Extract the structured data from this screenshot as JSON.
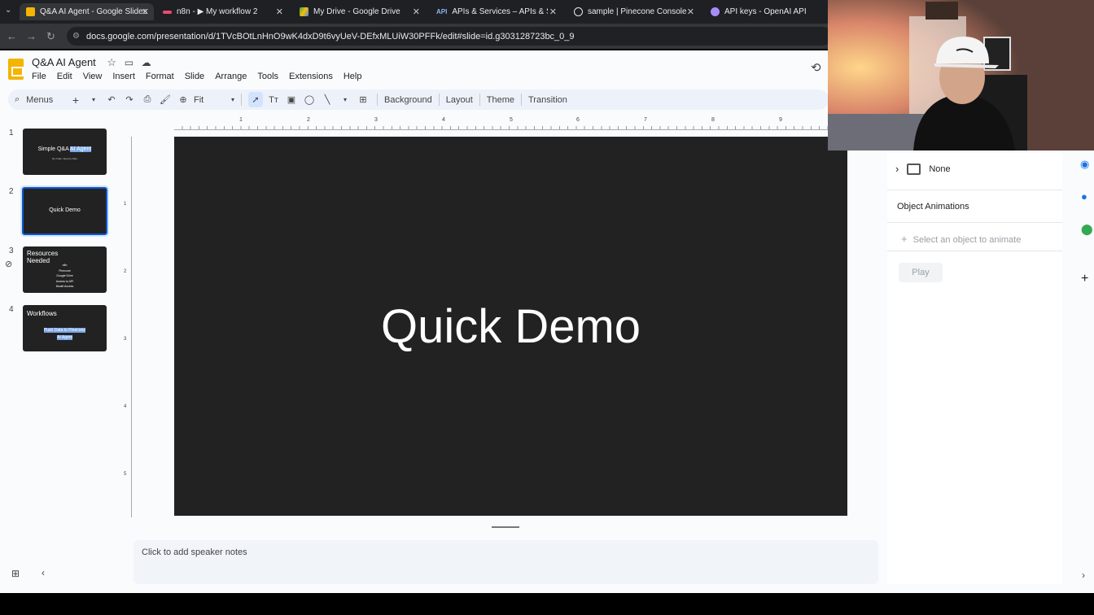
{
  "browser": {
    "tabs": [
      {
        "title": "Q&A AI Agent - Google Slides",
        "icon": "slides-icon",
        "color": "#f4b400"
      },
      {
        "title": "n8n - ▶ My workflow 2",
        "icon": "n8n-icon",
        "color": "#ea4b71"
      },
      {
        "title": "My Drive - Google Drive",
        "icon": "drive-icon",
        "color": "#34a853"
      },
      {
        "title": "APIs & Services – APIs & Servic",
        "icon": "api-icon",
        "color": "#8ab4f8"
      },
      {
        "title": "sample | Pinecone Console",
        "icon": "pinecone-icon",
        "color": "#e8eaed"
      },
      {
        "title": "API keys - OpenAI API",
        "icon": "openai-icon",
        "color": "#a78bfa"
      }
    ],
    "url": "docs.google.com/presentation/d/1TVcBOtLnHnO9wK4dxD9t6vyUeV-DEfxMLUiW30PFFk/edit#slide=id.g303128723bc_0_9"
  },
  "doc": {
    "title": "Q&A AI Agent",
    "menus": [
      "File",
      "Edit",
      "View",
      "Insert",
      "Format",
      "Slide",
      "Arrange",
      "Tools",
      "Extensions",
      "Help"
    ]
  },
  "toolbar": {
    "search": "Menus",
    "zoom": "Fit",
    "background": "Background",
    "layout": "Layout",
    "theme": "Theme",
    "transition": "Transition"
  },
  "ruler": {
    "h": [
      "1",
      "2",
      "3",
      "4",
      "5",
      "6",
      "7",
      "8",
      "9"
    ],
    "v": [
      "1",
      "2",
      "3",
      "4",
      "5"
    ]
  },
  "slides": [
    {
      "num": "1",
      "title": "Simple Q&A ",
      "highlight": "AI Agent",
      "sub": "No Code, Step-by-Step"
    },
    {
      "num": "2",
      "title": "Quick Demo"
    },
    {
      "num": "3",
      "title": "Resources Needed",
      "items": [
        "n8n",
        "Pinecone",
        "Google Drive",
        "Access to API",
        "Model Access"
      ]
    },
    {
      "num": "4",
      "title": "Workflows",
      "items": [
        "Push Data to Pinecone",
        "AI Agent"
      ]
    }
  ],
  "current_slide": {
    "title": "Quick Demo"
  },
  "notes_placeholder": "Click to add speaker notes",
  "panel": {
    "transition_value": "None",
    "object_animations": "Object Animations",
    "select_object": "Select an object to animate",
    "play": "Play"
  }
}
